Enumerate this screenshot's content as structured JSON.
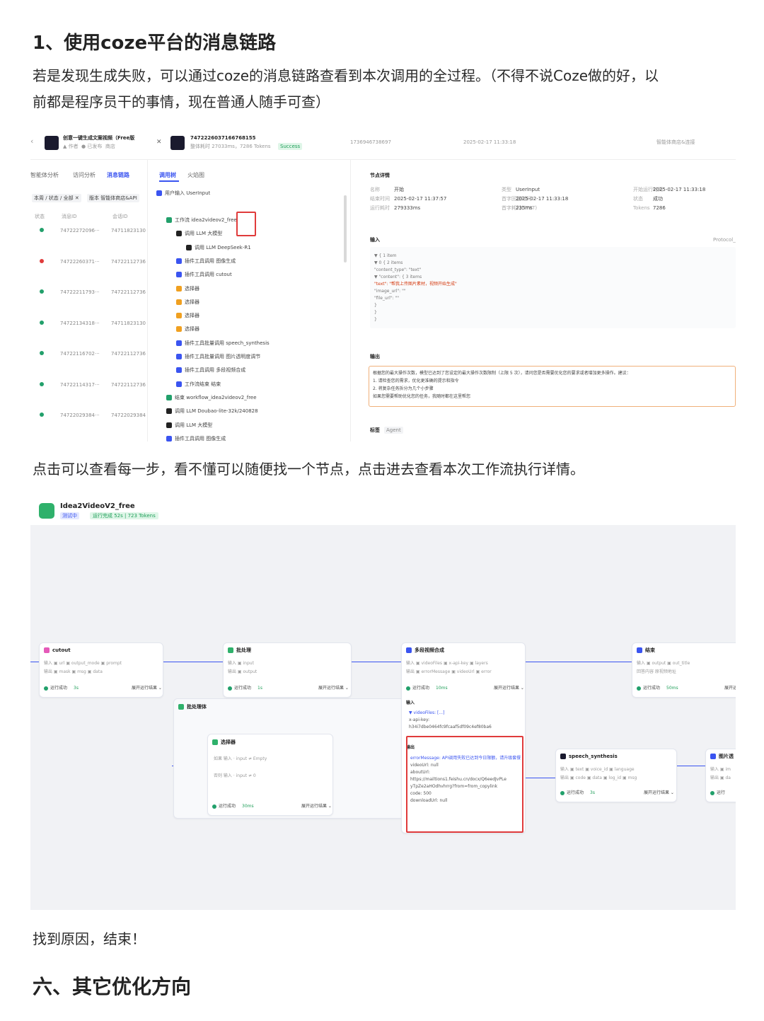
{
  "article": {
    "heading1": "1、使用coze平台的消息链路",
    "para1_line1": "若是发现生成失败，可以通过coze的消息链路查看到本次调用的全过程。（不得不说Coze做的好，以",
    "para1_line2": "前都是程序员干的事情，现在普通人随手可查）",
    "para2": "点击可以查看每一步，看不懂可以随便找一个节点，点击进去查看本次工作流执行详情。",
    "para3": "找到原因，结束！",
    "heading2": "六、其它优化方向"
  },
  "screenshot1": {
    "bot_name": "创意一键生成文案视频（Free版",
    "message_id": "7472226037166768155",
    "meta_1": "整体耗时 27033ms，7286 Tokens",
    "status": "Success",
    "header_meta": [
      "1736946738697",
      "2025-02-17 11:33:18",
      "智能体商店&连接"
    ],
    "left_tabs": [
      "智能体分析",
      "访问分析",
      "消息链路"
    ],
    "filter_chips": [
      "本周 / 状态 / 全部 ✕",
      "版本 智能体商店&API"
    ],
    "list_headers": [
      "状态",
      "消息ID",
      "会话ID"
    ],
    "list_rows": [
      {
        "status": "ok",
        "msg_id": "74722272096···",
        "conv_id": "74711823130"
      },
      {
        "status": "error",
        "msg_id": "74722260371···",
        "conv_id": "74722112736"
      },
      {
        "status": "ok",
        "msg_id": "74722211793···",
        "conv_id": "74722112736"
      },
      {
        "status": "ok",
        "msg_id": "74722134318···",
        "conv_id": "74711823130"
      },
      {
        "status": "ok",
        "msg_id": "74722116702···",
        "conv_id": "74722112736"
      },
      {
        "status": "ok",
        "msg_id": "74722114317···",
        "conv_id": "74722112736"
      },
      {
        "status": "ok",
        "msg_id": "74722029384···",
        "conv_id": "74722029384"
      }
    ],
    "tree_tabs": [
      "调用树",
      "火焰图"
    ],
    "tree_nodes": [
      {
        "label": "用户输入 UserInput",
        "color": "#3a54f0"
      },
      {
        "label": "工作流 idea2videov2_free",
        "color": "#22a06b"
      },
      {
        "label": "调用 LLM 大模型",
        "color": "#222222"
      },
      {
        "label": "调用 LLM DeepSeek-R1",
        "color": "#222222"
      },
      {
        "label": "插件工具调用 图像生成",
        "color": "#3a54f0"
      },
      {
        "label": "插件工具调用 cutout",
        "color": "#3a54f0"
      },
      {
        "label": "选择器",
        "color": "#f0a020"
      },
      {
        "label": "选择器",
        "color": "#f0a020"
      },
      {
        "label": "选择器",
        "color": "#f0a020"
      },
      {
        "label": "选择器",
        "color": "#f0a020"
      },
      {
        "label": "插件工具批量调用 speech_synthesis",
        "color": "#3a54f0"
      },
      {
        "label": "插件工具批量调用 图片透明度调节",
        "color": "#3a54f0"
      },
      {
        "label": "插件工具调用 多段视频合成",
        "color": "#3a54f0"
      },
      {
        "label": "工作流结束 结束",
        "color": "#3a54f0"
      },
      {
        "label": "结束 workflow_idea2videov2_free",
        "color": "#22a06b"
      },
      {
        "label": "调用 LLM Doubao-lite-32k/240828",
        "color": "#222222"
      },
      {
        "label": "调用 LLM 大模型",
        "color": "#222222"
      },
      {
        "label": "插件工具调用 图像生成",
        "color": "#3a54f0"
      }
    ],
    "detail_title": "节点详情",
    "detail_meta": [
      [
        "名称",
        "开始",
        "类型",
        "UserInput",
        "开始运行时间",
        "2025-02-17 11:33:18"
      ],
      [
        "结束时间",
        "2025-02-17 11:37:57",
        "首字回复时间",
        "2025-02-17 11:33:18",
        "状态",
        "成功"
      ],
      [
        "运行耗时",
        "279333ms",
        "首字耗时(TTFT)",
        "235ms",
        "Tokens",
        "7286"
      ]
    ],
    "input_label": "输入",
    "input_json": [
      "▼ {  1 item",
      "  ▼ 0 {  2 items",
      "      \"content_type\": \"text\"",
      "    ▼ \"content\": {  3 items",
      "        \"text\": \"帮我上传图片素材，视频开始生成\"",
      "        \"image_url\": \"\"",
      "        \"file_url\": \"\"",
      "      }",
      "    }",
      "  }"
    ],
    "input_protocol": "Protocol_s",
    "output_label": "输出",
    "output_lines": [
      "根据您的最大操作次数，模型已达到了您设定的最大操作次数限制（上限 5 次），请问您是否需要优化您的要求或者增加更多操作。建议：",
      "1. 请检查您的需求，优化更准确的提示和指令",
      "2. 将复杂任务拆分为几个小步骤",
      "如果您需要帮助优化您的任务，我随时都在这里帮您"
    ],
    "tags_label": "标签",
    "tags_value": "Agent"
  },
  "screenshot2": {
    "workflow_name": "Idea2VideoV2_free",
    "badge_left": "测试中",
    "badge_run": "运行完成 52s | 723 Tokens",
    "nodes": {
      "cutout": {
        "title": "cutout",
        "params": "输入  ▣ url  ▣ output_mode  ▣ prompt",
        "outputs": "输出  ▣ mask  ▣ msg  ▣ data",
        "status": "运行成功",
        "time": "3s",
        "link": "展开运行结果 ⌄"
      },
      "batch": {
        "title": "批处理",
        "params": "输入  ▣ input",
        "outputs": "输出  ▣ output",
        "status": "运行成功",
        "time": "1s",
        "link": "展开运行结果 ⌄"
      },
      "merge": {
        "title": "多段视频合成",
        "params": "输入  ▣ videoFiles  ▣ x-api-key  ▣ layers",
        "outputs": "输出  ▣ errorMessage  ▣ videoUrl  ▣ error",
        "status": "运行成功",
        "time": "10ms",
        "link": "展开运行结果 ⌄"
      },
      "end": {
        "title": "结束",
        "params": "输入  ▣ output  ▣ out_title",
        "outputs": "回答内容  原视频地址",
        "status": "运行成功",
        "time": "50ms",
        "link": "展开运行结果 ⌄"
      },
      "loop": {
        "title": "批处理体"
      },
      "selector": {
        "title": "选择器",
        "rows": [
          "如果  输入 · input    ≠    Empty",
          "否则  输入 · input    ≠    0"
        ],
        "status": "运行成功",
        "time": "30ms",
        "link": "展开运行结果 ⌄"
      },
      "speech": {
        "title": "speech_synthesis",
        "params": "输入  ▣ text  ▣ voice_id  ▣ language",
        "outputs": "输出  ▣ code  ▣ data  ▣ log_id  ▣ msg",
        "status": "运行成功",
        "time": "3s",
        "link": "展开运行结果 ⌄"
      },
      "image": {
        "title": "图片透",
        "params": "输入  ▣ im",
        "outputs": "输出  ▣ da",
        "status": "运行"
      }
    },
    "merge_input_title": "输入",
    "merge_input_lines": [
      "▼ videoFiles: [...]",
      "  x-api-key:",
      "  h34i7dbe0464fc9fcaaf5df09c4ef80ba6"
    ],
    "merge_output_title": "输出",
    "merge_output_lines": [
      "errorMessage: API调用失败已达到今日限额，请升级套餐",
      "videoUrl: null",
      "aboutUrl:",
      "https://mailtions1.feishu.cn/docx/Q6eedJvPLe",
      "yTpZe2aHOdhvhrrg?from=from_copylink",
      "code: 500",
      "downloadUrl: null"
    ]
  }
}
